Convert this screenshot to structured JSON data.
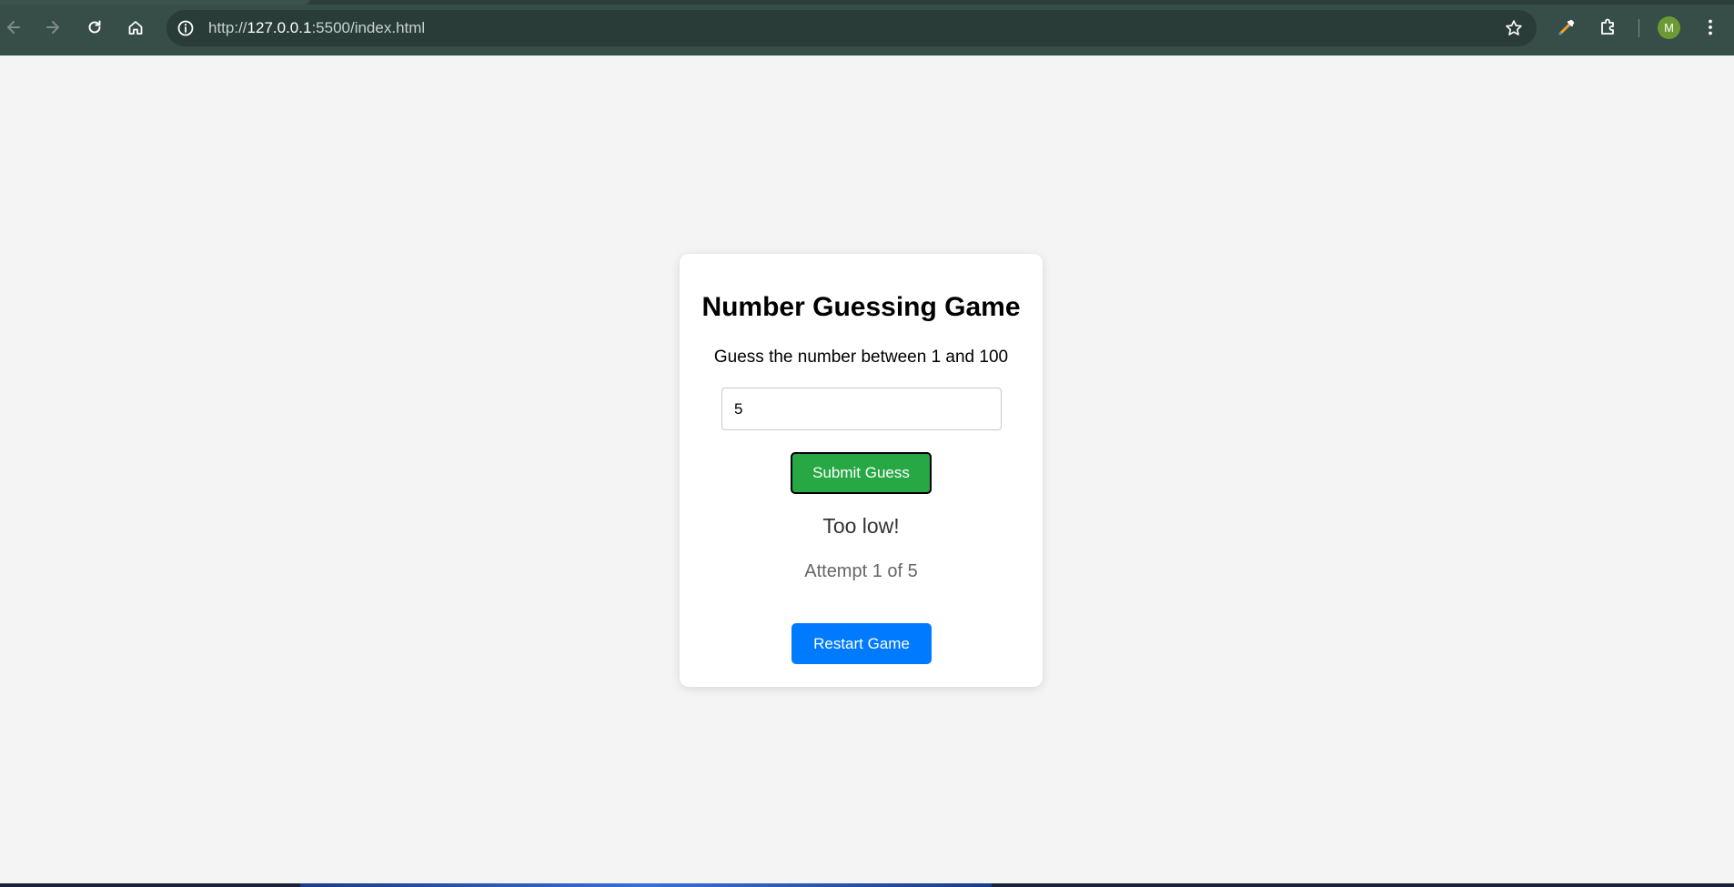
{
  "browser": {
    "url_prefix": "http://",
    "url_host": "127.0.0.1",
    "url_rest": ":5500/index.html",
    "profile_initial": "M",
    "icons": {
      "back": "arrow-left-icon",
      "forward": "arrow-right-icon",
      "reload": "reload-icon",
      "home": "home-icon",
      "site_info": "info-icon",
      "bookmark": "star-icon",
      "eyedropper": "eyedropper-icon",
      "extensions": "puzzle-icon",
      "menu": "kebab-menu-icon"
    },
    "colors": {
      "chrome": "#374d48",
      "omnibox": "#2a3c38",
      "avatar": "#6e9a35"
    }
  },
  "game": {
    "title": "Number Guessing Game",
    "instruction": "Guess the number between 1 and 100",
    "input_value": "5",
    "submit_label": "Submit Guess",
    "message": "Too low!",
    "attempts": "Attempt 1 of 5",
    "restart_label": "Restart Game",
    "colors": {
      "submit": "#28a745",
      "restart": "#007bff",
      "page_bg": "#f4f4f4"
    }
  }
}
